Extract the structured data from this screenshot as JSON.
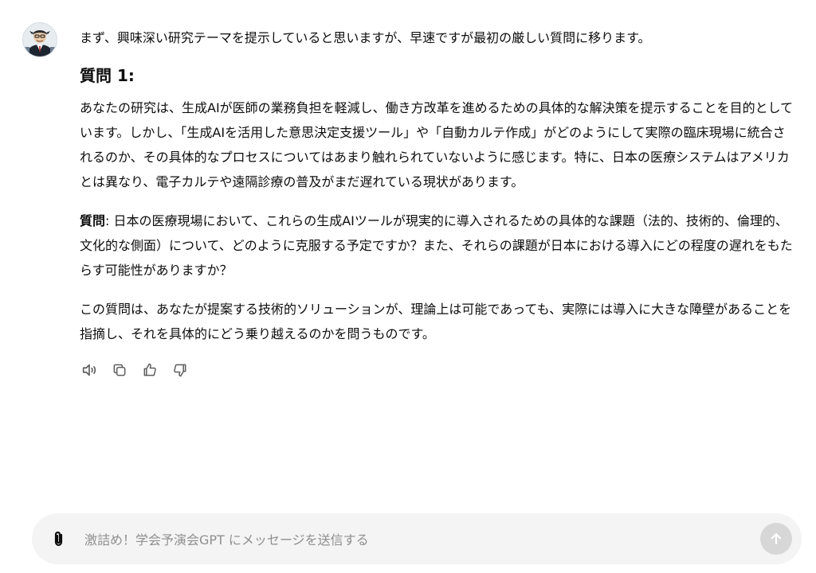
{
  "conversation": {
    "intro": "まず、興味深い研究テーマを提示していると思いますが、早速ですが最初の厳しい質問に移ります。",
    "heading": "質問 1:",
    "paragraph1": "あなたの研究は、生成AIが医師の業務負担を軽減し、働き方改革を進めるための具体的な解決策を提示することを目的としています。しかし、「生成AIを活用した意思決定支援ツール」や「自動カルテ作成」がどのようにして実際の臨床現場に統合されるのか、その具体的なプロセスについてはあまり触れられていないように感じます。特に、日本の医療システムはアメリカとは異なり、電子カルテや遠隔診療の普及がまだ遅れている現状があります。",
    "question_label": "質問",
    "question_colon": ": ",
    "question_text": "日本の医療現場において、これらの生成AIツールが現実的に導入されるための具体的な課題（法的、技術的、倫理的、文化的な側面）について、どのように克服する予定ですか？また、それらの課題が日本における導入にどの程度の遅れをもたらす可能性がありますか？",
    "paragraph3": "この質問は、あなたが提案する技術的ソリューションが、理論上は可能であっても、実際には導入に大きな障壁があることを指摘し、それを具体的にどう乗り越えるのかを問うものです。"
  },
  "actions": {
    "icons": [
      "speaker-icon",
      "copy-icon",
      "thumbs-up-icon",
      "thumbs-down-icon"
    ]
  },
  "composer": {
    "placeholder": "激詰め！学会予演会GPT にメッセージを送信する"
  },
  "colors": {
    "text": "#0d0d0d",
    "composer_bg": "#f4f4f4",
    "send_button_bg": "#d7d7d7",
    "icon": "#5d5d5d"
  }
}
